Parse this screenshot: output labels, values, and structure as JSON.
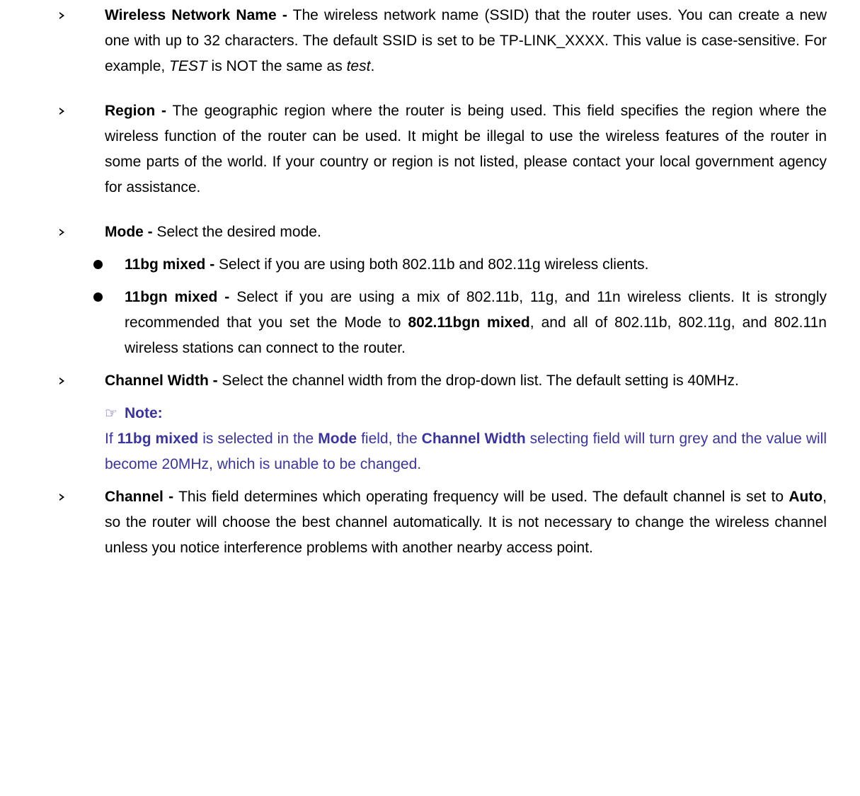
{
  "ssid": {
    "term": "Wireless Network Name -",
    "text1": " The wireless network name (SSID) that the router uses. You can create a new one with up to 32 characters. The default SSID is set to be TP-LINK_XXXX. This value is case-sensitive. For example, ",
    "em1": "TEST",
    "text2": " is NOT the same as ",
    "em2": "test",
    "text3": "."
  },
  "region": {
    "term": "Region -",
    "text": " The geographic region where the router is being used. This field specifies the region where the wireless function of the router can be used. It might be illegal to use the wireless features of the router in some parts of the world. If your country or region is not listed, please contact your local government agency for assistance."
  },
  "mode": {
    "term": "Mode -",
    "text": " Select the desired mode.",
    "options": [
      {
        "term": "11bg mixed -",
        "text": " Select if you are using both 802.11b and 802.11g wireless clients."
      },
      {
        "term": "11bgn mixed -",
        "text1": " Select if you are using a mix of 802.11b, 11g, and 11n wireless clients. It is strongly recommended that you set the Mode to ",
        "bold": "802.11bgn mixed",
        "text2": ", and all of 802.11b, 802.11g, and 802.11n wireless stations can connect to the router."
      }
    ]
  },
  "channel_width": {
    "term": "Channel Width -",
    "text": " Select the channel width from the drop-down list. The default setting is 40MHz."
  },
  "note": {
    "icon": "☞",
    "heading": "Note:",
    "text1": "If ",
    "b1": "11bg mixed",
    "text2": " is selected in the ",
    "b2": "Mode",
    "text3": " field, the ",
    "b3": "Channel Width",
    "text4": " selecting field will turn grey and the value will become 20MHz, which is unable to be changed."
  },
  "channel": {
    "term": "Channel -",
    "text1": " This field determines which operating frequency will be used. The default channel is set to ",
    "bold": "Auto",
    "text2": ", so the router will choose the best channel automatically. It is not necessary to change the wireless channel unless you notice interference problems with another nearby access point."
  }
}
